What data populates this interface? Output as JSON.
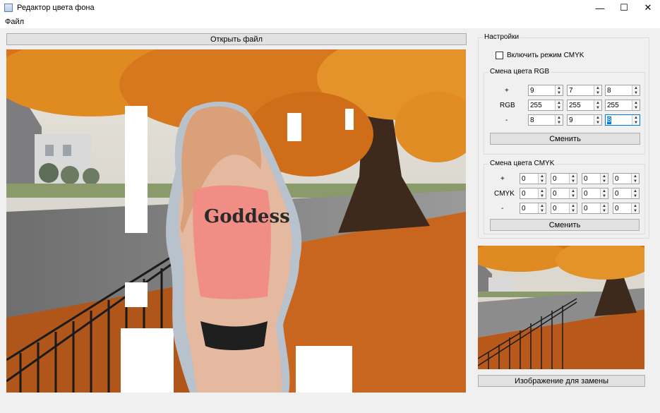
{
  "window": {
    "title": "Редактор цвета фона",
    "minimize": "—",
    "maximize": "☐",
    "close": "✕"
  },
  "menu": {
    "file": "Файл"
  },
  "open_button": "Открыть файл",
  "settings": {
    "title": "Настройки",
    "cmyk_checkbox_label": "Включить режим CMYK",
    "cmyk_checked": false,
    "rgb_group": {
      "title": "Смена цвета RGB",
      "row_labels": [
        "+",
        "RGB",
        "-"
      ],
      "rows": [
        [
          "9",
          "7",
          "8"
        ],
        [
          "255",
          "255",
          "255"
        ],
        [
          "8",
          "9",
          "8"
        ]
      ],
      "apply": "Сменить"
    },
    "cmyk_group": {
      "title": "Смена цвета CMYK",
      "row_labels": [
        "+",
        "CMYK",
        "-"
      ],
      "rows": [
        [
          "0",
          "0",
          "0",
          "0"
        ],
        [
          "0",
          "0",
          "0",
          "0"
        ],
        [
          "0",
          "0",
          "0",
          "0"
        ]
      ],
      "apply": "Сменить"
    }
  },
  "replace_button": "Изображение для замены",
  "image_text": "Goddess"
}
